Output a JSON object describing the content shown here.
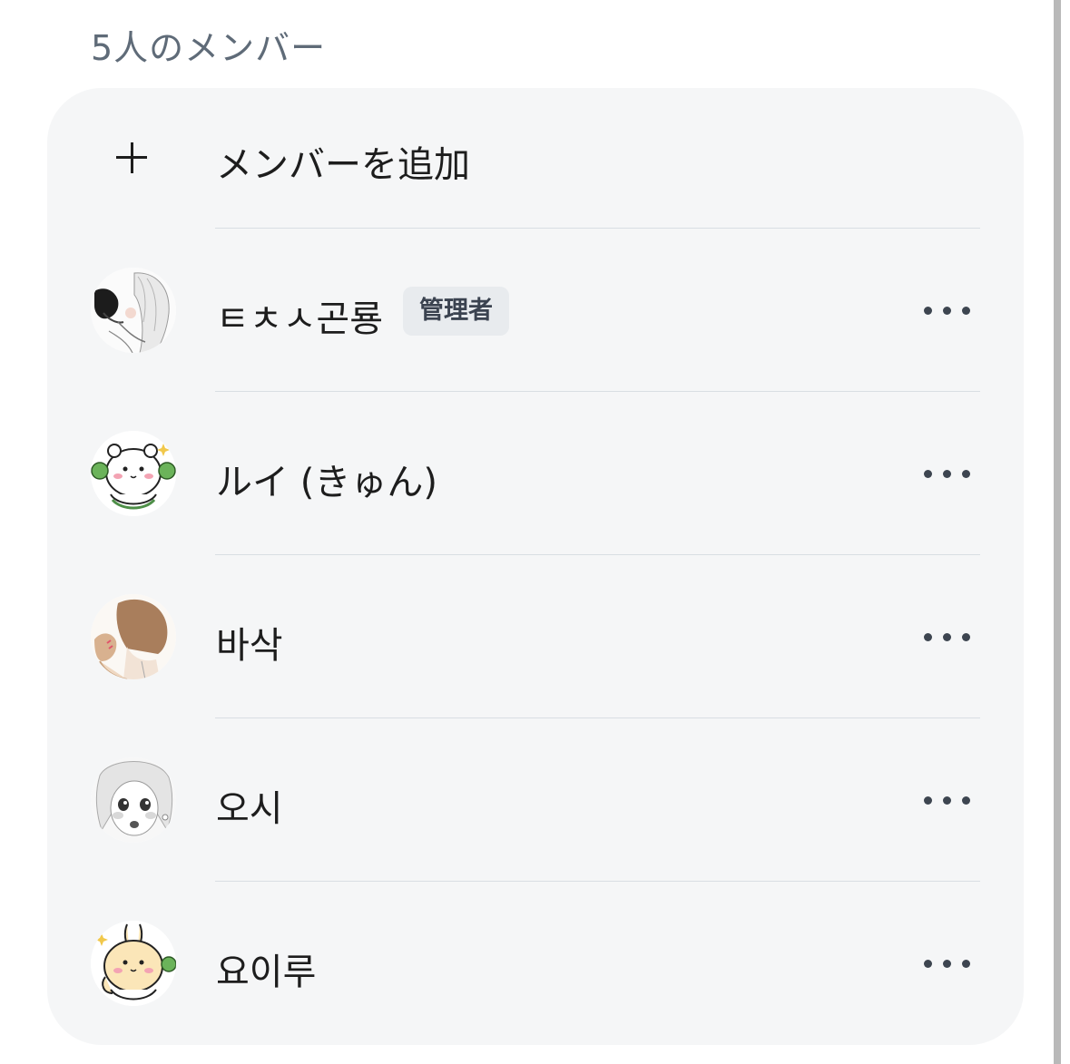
{
  "header": {
    "title": "5人のメンバー"
  },
  "add_member": {
    "label": "メンバーを追加",
    "icon": "plus-icon"
  },
  "members": [
    {
      "name": "ㅌㅊㅅ곤룡",
      "badge": "管理者",
      "avatar": "manga-couple-avatar"
    },
    {
      "name": "ルイ (きゅん)",
      "badge": "",
      "avatar": "bear-character-avatar"
    },
    {
      "name": "바삭",
      "badge": "",
      "avatar": "brown-hair-avatar"
    },
    {
      "name": "오시",
      "badge": "",
      "avatar": "manga-girl-avatar"
    },
    {
      "name": "요이루",
      "badge": "",
      "avatar": "rabbit-character-avatar"
    }
  ],
  "colors": {
    "card_bg": "#f5f6f7",
    "title": "#5f6b78",
    "badge_bg": "#e8ebee",
    "text": "#1d1d1d"
  }
}
